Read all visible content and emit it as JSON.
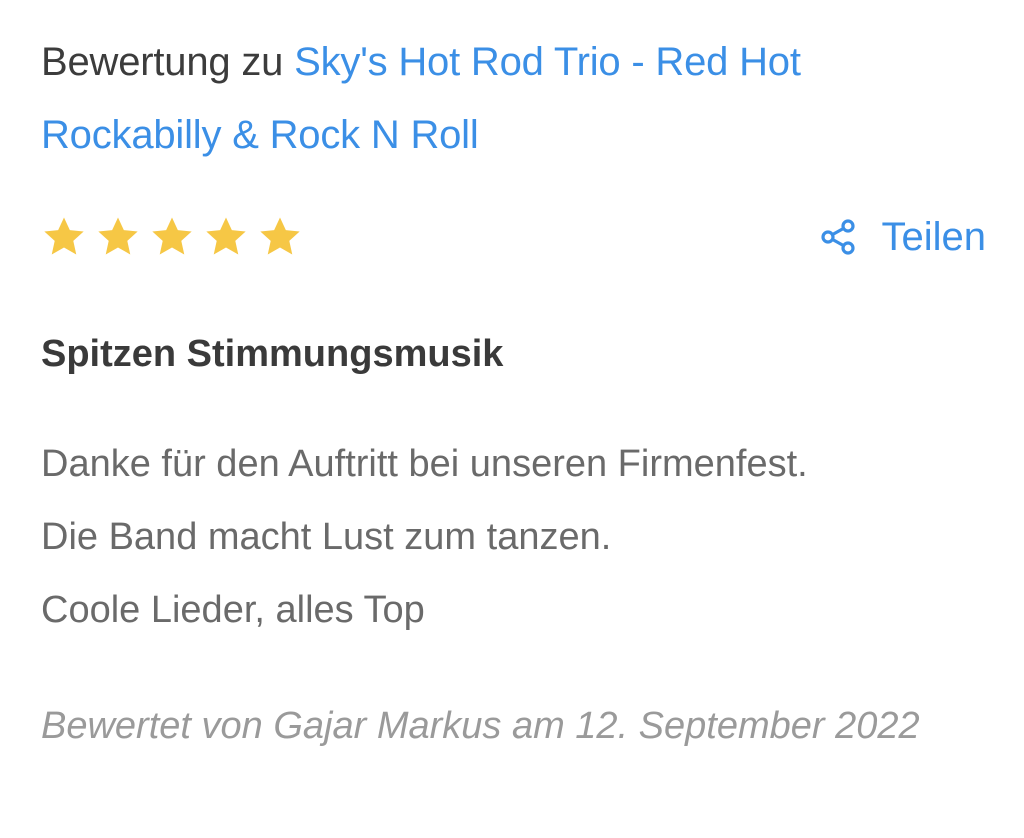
{
  "review": {
    "heading_prefix": "Bewertung zu ",
    "heading_link": "Sky's Hot Rod Trio - Red Hot Rockabilly & Rock N Roll",
    "rating": 5,
    "rating_max": 5,
    "share_label": "Teilen",
    "title": "Spitzen Stimmungsmusik",
    "body_lines": [
      "Danke für den Auftritt bei unseren Firmenfest.",
      "Die Band macht Lust zum tanzen.",
      "Coole Lieder, alles Top"
    ],
    "byline": "Bewertet von Gajar Markus am 12. September 2022"
  },
  "colors": {
    "link": "#3b8fe6",
    "star": "#f6c745",
    "heading_text": "#3c3c3c",
    "body_text": "#6a6a6a",
    "byline_text": "#9a9a9a"
  },
  "icons": {
    "star": "star-icon",
    "share": "share-icon"
  }
}
